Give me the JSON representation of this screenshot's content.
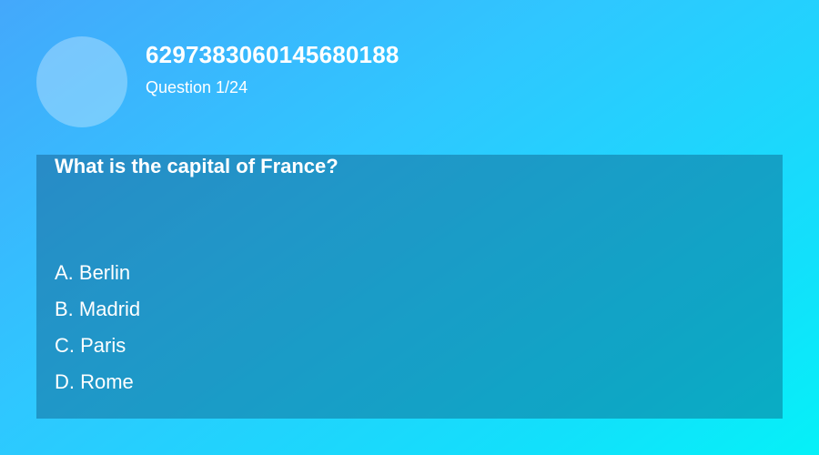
{
  "header": {
    "id_text": "6297383060145680188",
    "progress_text": "Question 1/24"
  },
  "question": {
    "text": "What is the capital of France?",
    "options": [
      "A. Berlin",
      "B. Madrid",
      "C. Paris",
      "D. Rome"
    ]
  },
  "colors": {
    "gradient_start": "#44a8fb",
    "gradient_end": "#05f1f8",
    "text": "#ffffff"
  }
}
